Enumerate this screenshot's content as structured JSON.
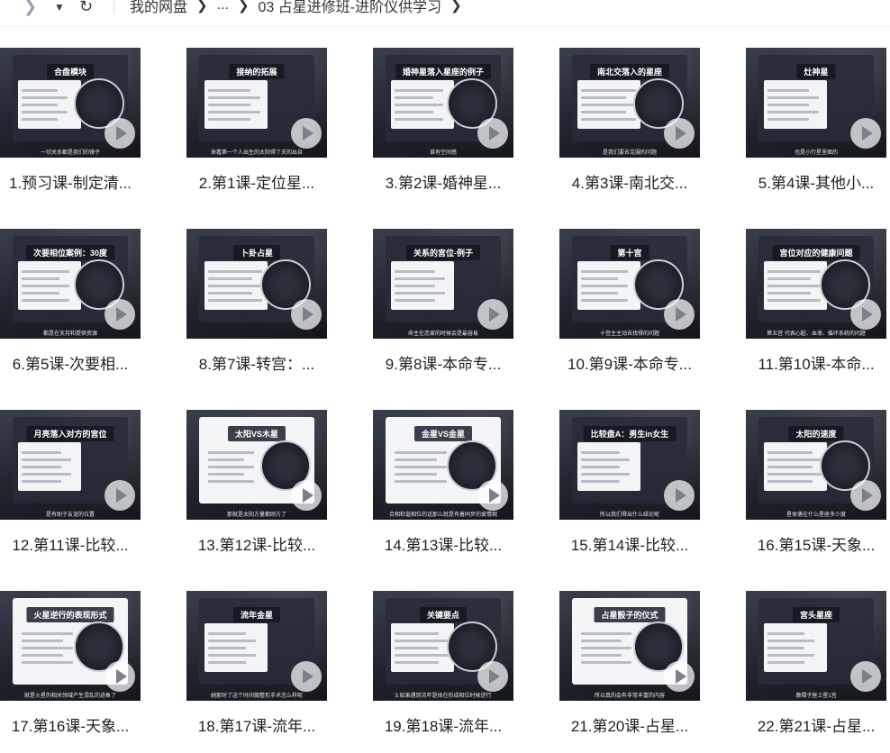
{
  "breadcrumb": {
    "root": "我的网盘",
    "ellipsis": "...",
    "current": "03 占星进修班-进阶仪供学习"
  },
  "icons": {
    "back": "chevron-left-icon",
    "dropdown": "caret-down-icon",
    "refresh": "refresh-icon",
    "play": "play-icon"
  },
  "files": [
    {
      "label": "1.预习课-制定清...",
      "slide_title": "合盘模块",
      "caption": "一切关系都是我们的镜子",
      "style": "dark"
    },
    {
      "label": "2.第1课-定位星...",
      "slide_title": "接纳的拓展",
      "caption": "来看第一个人出生的太阳得了夫的出自",
      "style": "dark"
    },
    {
      "label": "3.第2课-婚神星...",
      "slide_title": "婚神星落入星座的例子",
      "caption": "谁有空间感",
      "style": "dark"
    },
    {
      "label": "4.第3课-南北交...",
      "slide_title": "南北交落入的星座",
      "caption": "是我们要去克服的问题",
      "style": "dark"
    },
    {
      "label": "5.第4课-其他小...",
      "slide_title": "灶神星",
      "caption": "也是小行星里面的",
      "style": "dark"
    },
    {
      "label": "6.第5课-次要相...",
      "slide_title": "次要相位案例：30度",
      "caption": "都是在支持和提供资源",
      "style": "dark"
    },
    {
      "label": "8.第7课-转宫：...",
      "slide_title": "卜卦占星",
      "caption": "",
      "style": "dark"
    },
    {
      "label": "9.第8课-本命专...",
      "slide_title": "关系的宫位-例子",
      "caption": "命主在恋爱的时候会是最容易",
      "style": "dark"
    },
    {
      "label": "10.第9课-本命专...",
      "slide_title": "第十宫",
      "caption": "十宫主主动去找得的问题",
      "style": "dark"
    },
    {
      "label": "11.第10课-本命...",
      "slide_title": "宫位对应的健康问题",
      "caption": "第五宫 代表心脏、血液、循环系统的问题",
      "style": "dark"
    },
    {
      "label": "12.第11课-比较...",
      "slide_title": "月亮落入对方的宫位",
      "caption": "是有助于友谊的位置",
      "style": "dark"
    },
    {
      "label": "13.第12课-比较...",
      "slide_title": "太阳VS木星",
      "caption": "那就是太阳方量都刚方了",
      "style": "light"
    },
    {
      "label": "14.第13课-比较...",
      "slide_title": "金星VS金星",
      "caption": "合相和谐相位的话那么就是有着同步的爱情观",
      "style": "light"
    },
    {
      "label": "15.第14课-比较...",
      "slide_title": "比较盘A：男生in女生",
      "caption": "所以我们得出什么结论呢",
      "style": "dark"
    },
    {
      "label": "16.第15课-天象...",
      "slide_title": "太阳的速度",
      "caption": "星体落在什么星座多少度",
      "style": "dark"
    },
    {
      "label": "17.第16课-天象...",
      "slide_title": "火星逆行的表现形式",
      "caption": "就是火星的相关领域产生混乱的迹象了",
      "style": "light"
    },
    {
      "label": "18.第17课-流年...",
      "slide_title": "流年金星",
      "caption": "她那时了这个时间做整形手术怎么样呢",
      "style": "dark"
    },
    {
      "label": "19.第18课-流年...",
      "slide_title": "关键要点",
      "caption": "3.如果遇到流年是体在形成相位时候逆行",
      "style": "dark"
    },
    {
      "label": "21.第20课-占星...",
      "slide_title": "占星骰子的仪式",
      "caption": "所以真的会有非常丰富的内容",
      "style": "light"
    },
    {
      "label": "22.第21课-占星...",
      "slide_title": "宫头星座",
      "caption": "摩羯子座土星1宫",
      "style": "dark"
    }
  ]
}
